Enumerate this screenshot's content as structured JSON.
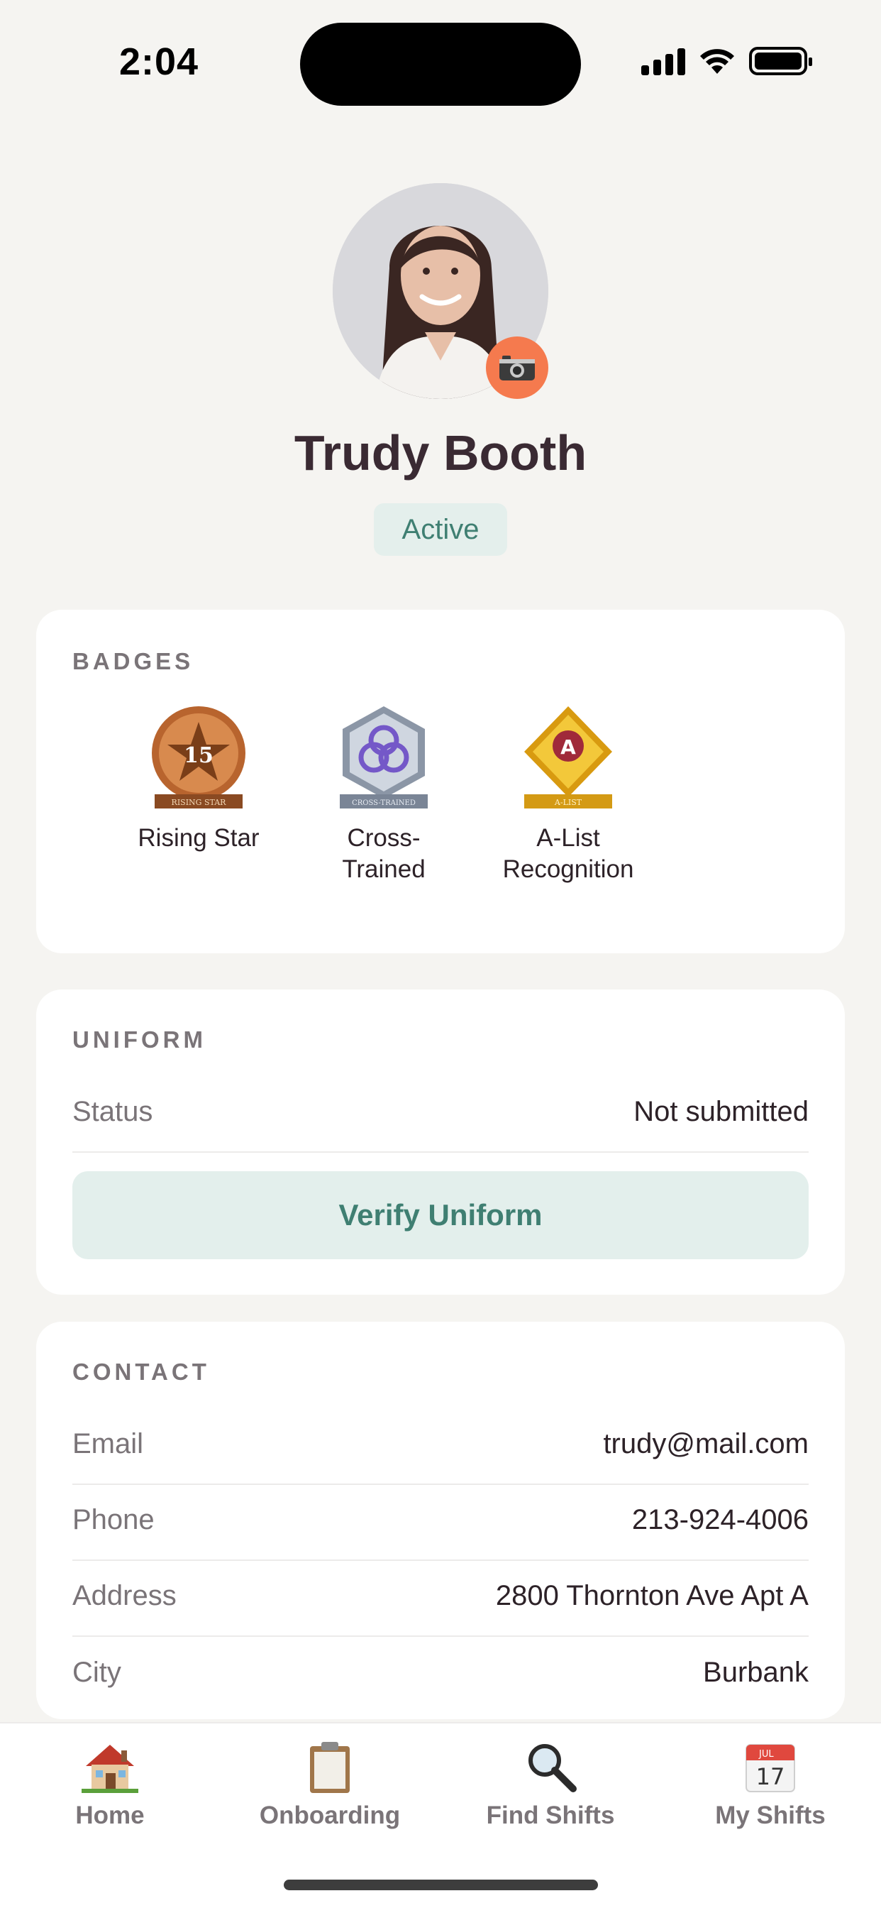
{
  "status_bar": {
    "time": "2:04"
  },
  "profile": {
    "name": "Trudy Booth",
    "status": "Active",
    "camera_icon": "camera-icon"
  },
  "badges": {
    "title": "BADGES",
    "items": [
      {
        "label": "Rising Star",
        "icon": "rising-star-medal-icon",
        "medal_number": "15",
        "ribbon": "RISING STAR",
        "color": "#c6763c"
      },
      {
        "label": "Cross-\nTrained",
        "line1": "Cross-",
        "line2": "Trained",
        "icon": "cross-trained-hexagon-icon",
        "ribbon": "CROSS-TRAINED",
        "color": "#9aa7b8"
      },
      {
        "label": "A-List Recognition",
        "line1": "A-List",
        "line2": "Recognition",
        "icon": "a-list-diamond-icon",
        "medal_letter": "A",
        "ribbon": "A-LIST",
        "color": "#e7b21e"
      }
    ]
  },
  "uniform": {
    "title": "UNIFORM",
    "status_label": "Status",
    "status_value": "Not submitted",
    "button": "Verify Uniform"
  },
  "contact": {
    "title": "CONTACT",
    "rows": [
      {
        "label": "Email",
        "value": "trudy@mail.com"
      },
      {
        "label": "Phone",
        "value": "213-924-4006"
      },
      {
        "label": "Address",
        "value": "2800 Thornton Ave Apt A"
      },
      {
        "label": "City",
        "value": "Burbank"
      }
    ]
  },
  "tabs": [
    {
      "label": "Home",
      "icon": "house-icon"
    },
    {
      "label": "Onboarding",
      "icon": "clipboard-icon"
    },
    {
      "label": "Find Shifts",
      "icon": "magnifying-glass-icon"
    },
    {
      "label": "My Shifts",
      "icon": "calendar-icon",
      "calendar_month": "JUL",
      "calendar_day": "17"
    }
  ],
  "colors": {
    "accent_teal": "#3f7f72",
    "accent_teal_bg": "#e3efec",
    "camera_orange": "#f57a4e",
    "background": "#f5f4f1"
  }
}
